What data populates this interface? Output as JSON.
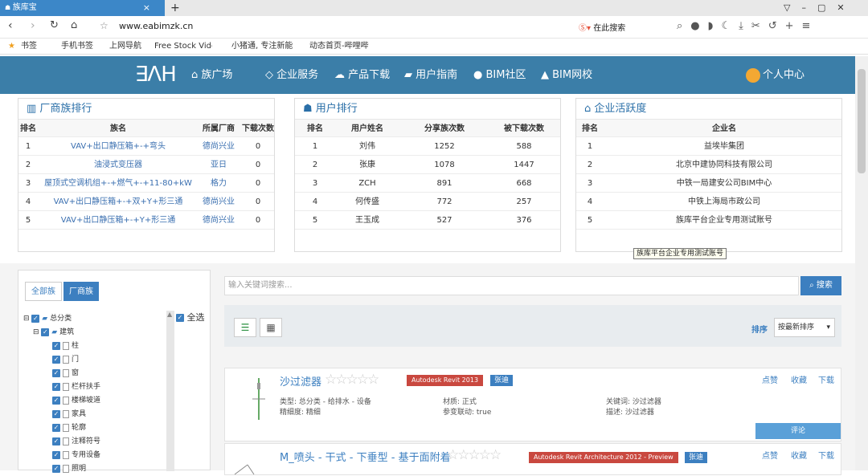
{
  "browser": {
    "tab_title": "族库宝",
    "url": "www.eabimzk.cn",
    "search_engine_label": "在此搜索",
    "bookmarks": [
      "书签",
      "手机书签",
      "上网导航",
      "Free Stock Video",
      "小猪通, 专注新能",
      "动态首页-哔哩哔"
    ]
  },
  "site": {
    "logo_text": "∃ΛH",
    "nav": [
      "族广场",
      "企业服务",
      "产品下载",
      "用户指南",
      "BIM社区",
      "BIM网校"
    ],
    "user_center": "个人中心"
  },
  "family_rank": {
    "title": "厂商族排行",
    "headers": [
      "排名",
      "族名",
      "所属厂商",
      "下载次数"
    ],
    "rows": [
      [
        "1",
        "VAV+出口静压箱+-+弯头",
        "德尚兴业",
        "0"
      ],
      [
        "2",
        "油浸式变压器",
        "亚日",
        "0"
      ],
      [
        "3",
        "屋顶式空调机组+-+燃气+-+11-80+kW",
        "格力",
        "0"
      ],
      [
        "4",
        "VAV+出口静压箱+-+双+Y+形三通",
        "德尚兴业",
        "0"
      ],
      [
        "5",
        "VAV+出口静压箱+-+Y+形三通",
        "德尚兴业",
        "0"
      ]
    ]
  },
  "user_rank": {
    "title": "用户排行",
    "headers": [
      "排名",
      "用户姓名",
      "分享族次数",
      "被下载次数"
    ],
    "rows": [
      [
        "1",
        "刘伟",
        "1252",
        "588"
      ],
      [
        "2",
        "张康",
        "1078",
        "1447"
      ],
      [
        "3",
        "ZCH",
        "891",
        "668"
      ],
      [
        "4",
        "何传盛",
        "772",
        "257"
      ],
      [
        "5",
        "王玉成",
        "527",
        "376"
      ]
    ]
  },
  "enterprise_rank": {
    "title": "企业活跃度",
    "headers": [
      "排名",
      "企业名"
    ],
    "rows": [
      [
        "1",
        "益埃毕集团"
      ],
      [
        "2",
        "北京中建协同科技有限公司"
      ],
      [
        "3",
        "中铁一局建安公司BIM中心"
      ],
      [
        "4",
        "中铁上海局市政公司"
      ],
      [
        "5",
        "族库平台企业专用测试账号"
      ]
    ],
    "tooltip": "族库平台企业专用测试账号"
  },
  "filter": {
    "tab_all": "全部族",
    "tab_vendor": "厂商族",
    "select_all": "全选",
    "tree_root": "总分类",
    "tree_group": "建筑",
    "tree_items": [
      "柱",
      "门",
      "窗",
      "栏杆扶手",
      "楼梯坡道",
      "家具",
      "轮廓",
      "注释符号",
      "专用设备",
      "照明"
    ]
  },
  "search": {
    "placeholder": "输入关键词搜索...",
    "button": "搜索",
    "sort_label": "排序",
    "sort_value": "按最新排序"
  },
  "results": [
    {
      "title": "沙过滤器",
      "software": "Autodesk Revit 2013",
      "author": "张迪",
      "type": "类型: 总分类 - 给排水 - 设备",
      "detail": "精细度: 精细",
      "material": "材质: 正式",
      "param": "参变联动: true",
      "keyword": "关键词: 沙过滤器",
      "desc": "描述: 沙过滤器",
      "actions": [
        "点赞",
        "收藏",
        "下载"
      ],
      "comment": "评论"
    },
    {
      "title": "M_喷头 - 干式 - 下垂型 - 基于面附着",
      "software": "Autodesk Revit Architecture 2012 - Preview",
      "author": "张迪",
      "actions": [
        "点赞",
        "收藏",
        "下载"
      ]
    }
  ],
  "colors": {
    "header": "#3b7ea8",
    "accent": "#3c7fc0",
    "badge_red": "#c9483f",
    "link": "#3a6fb0"
  }
}
